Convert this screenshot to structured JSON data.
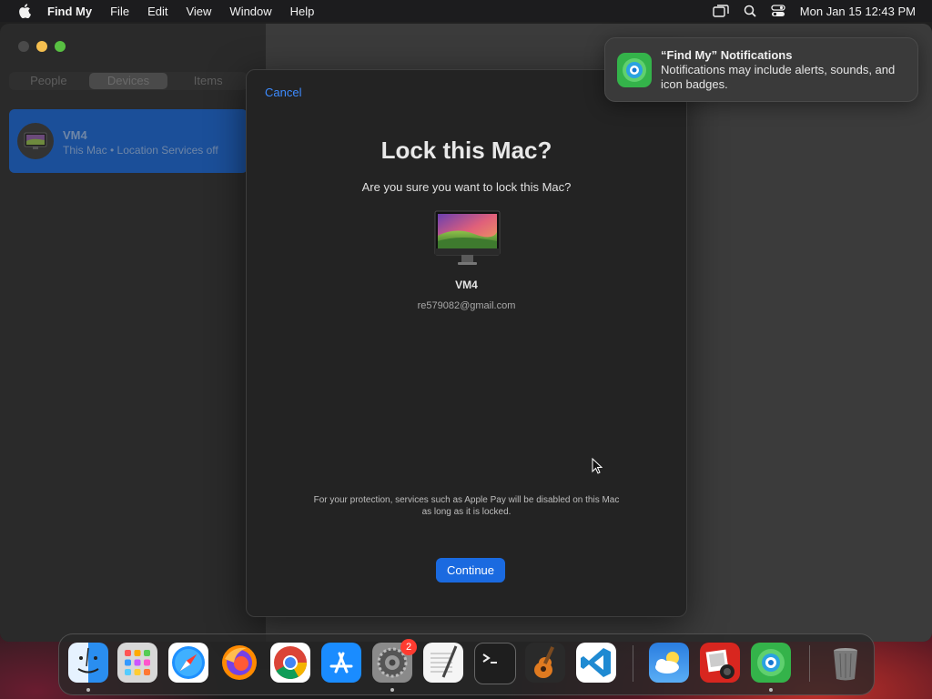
{
  "menubar": {
    "app_name": "Find My",
    "menus": [
      "File",
      "Edit",
      "View",
      "Window",
      "Help"
    ],
    "clock": "Mon Jan 15  12:43 PM"
  },
  "sidebar": {
    "tabs": [
      "People",
      "Devices",
      "Items"
    ],
    "active_tab": "Devices",
    "device": {
      "name": "VM4",
      "subtitle": "This Mac • Location Services off"
    }
  },
  "dialog": {
    "cancel_label": "Cancel",
    "title": "Lock this Mac?",
    "question": "Are you sure you want to lock this Mac?",
    "device_name": "VM4",
    "account": "re579082@gmail.com",
    "note": "For your protection, services such as Apple Pay will be disabled on this Mac as long as it is locked.",
    "continue_label": "Continue"
  },
  "notification": {
    "title": "“Find My” Notifications",
    "body": "Notifications may include alerts, sounds, and icon badges."
  },
  "dock": {
    "apps": [
      {
        "name": "Finder",
        "icon": "finder-icon"
      },
      {
        "name": "Launchpad",
        "icon": "launchpad-icon"
      },
      {
        "name": "Safari",
        "icon": "safari-icon"
      },
      {
        "name": "Firefox",
        "icon": "firefox-icon"
      },
      {
        "name": "Google Chrome",
        "icon": "chrome-icon"
      },
      {
        "name": "App Store",
        "icon": "app-store-icon"
      },
      {
        "name": "System Settings",
        "icon": "system-settings-icon",
        "badge": "2"
      },
      {
        "name": "TextEdit",
        "icon": "textedit-icon"
      },
      {
        "name": "Terminal",
        "icon": "terminal-icon"
      },
      {
        "name": "GarageBand",
        "icon": "garageband-icon"
      },
      {
        "name": "Visual Studio Code",
        "icon": "vscode-icon"
      },
      {
        "name": "Weather",
        "icon": "weather-icon"
      },
      {
        "name": "Photo Booth",
        "icon": "photo-booth-icon"
      },
      {
        "name": "Find My",
        "icon": "find-my-icon"
      },
      {
        "name": "Trash",
        "icon": "trash-icon"
      }
    ]
  },
  "colors": {
    "accent": "#1a6ae0",
    "link": "#3d8bff",
    "selection": "#1b4f99"
  }
}
